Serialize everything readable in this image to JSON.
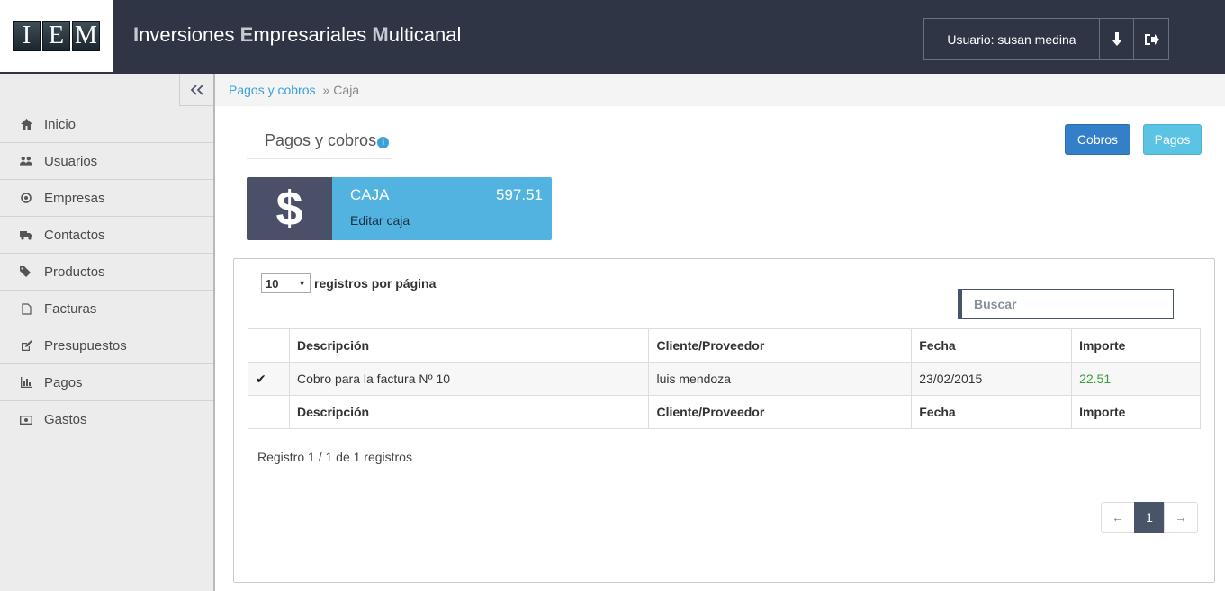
{
  "header": {
    "logo": [
      "I",
      "E",
      "M"
    ],
    "title_parts": [
      {
        "init": "I",
        "rest": "nversiones "
      },
      {
        "init": "E",
        "rest": "mpresariales "
      },
      {
        "init": "M",
        "rest": "ulticanal"
      }
    ],
    "user_label": "Usuario: susan medina",
    "download_icon": "arrow-down-icon",
    "logout_icon": "sign-out-icon"
  },
  "sidebar": {
    "collapse_icon": "double-chevron-left-icon",
    "items": [
      {
        "label": "Inicio",
        "icon": "home-icon"
      },
      {
        "label": "Usuarios",
        "icon": "users-icon"
      },
      {
        "label": "Empresas",
        "icon": "dot-circle-icon"
      },
      {
        "label": "Contactos",
        "icon": "truck-icon"
      },
      {
        "label": "Productos",
        "icon": "tags-icon"
      },
      {
        "label": "Facturas",
        "icon": "file-icon"
      },
      {
        "label": "Presupuestos",
        "icon": "edit-icon"
      },
      {
        "label": "Pagos",
        "icon": "bar-chart-icon"
      },
      {
        "label": "Gastos",
        "icon": "money-icon"
      }
    ]
  },
  "breadcrumb": {
    "link": "Pagos y cobros",
    "separator": "»",
    "current": "Caja"
  },
  "page": {
    "heading": "Pagos y cobros",
    "info_icon": "i",
    "cobros_label": "Cobros",
    "pagos_label": "Pagos"
  },
  "caja": {
    "icon": "$",
    "title": "CAJA",
    "amount": "597.51",
    "edit_label": "Editar caja"
  },
  "table": {
    "length_value": "10",
    "length_suffix": "registros por página",
    "search_placeholder": "Buscar",
    "columns": [
      "",
      "Descripción",
      "Cliente/Proveedor",
      "Fecha",
      "Importe"
    ],
    "rows": [
      {
        "check": "✔",
        "descripcion": "Cobro para la factura Nº 10",
        "cliente": "luis mendoza",
        "fecha": "23/02/2015",
        "importe": "22.51"
      }
    ],
    "info": "Registro 1 / 1 de 1 registros",
    "pager": {
      "prev": "←",
      "current": "1",
      "next": "→"
    }
  },
  "colors": {
    "header_bg": "#2f3544",
    "accent_blue": "#3380c9",
    "light_blue": "#5bc3e3",
    "caja_blue": "#52b3e0",
    "dark_slate": "#4a5068",
    "positive_green": "#3c9d3c",
    "link_blue": "#3aa1d8"
  }
}
